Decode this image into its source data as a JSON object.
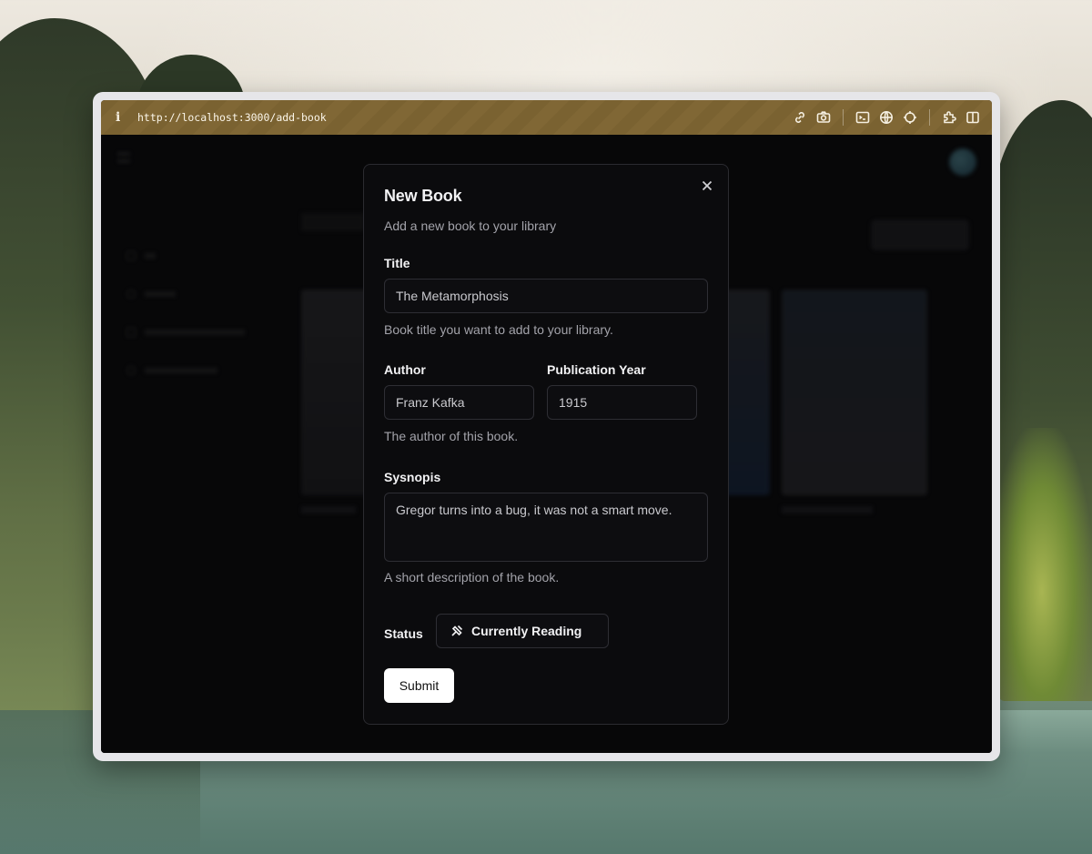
{
  "browser": {
    "url": "http://localhost:3000/add-book",
    "toolbar_icons": [
      "link-icon",
      "camera-icon",
      "terminal-icon",
      "globe-icon",
      "crosshair-icon",
      "extension-icon",
      "sidebar-icon"
    ]
  },
  "dialog": {
    "title": "New Book",
    "description": "Add a new book to your library",
    "title_field": {
      "label": "Title",
      "value": "The Metamorphosis",
      "help": "Book title you want to add to your library."
    },
    "author_field": {
      "label": "Author",
      "value": "Franz Kafka",
      "help": "The author of this book."
    },
    "year_field": {
      "label": "Publication Year",
      "value": "1915"
    },
    "synopsis_field": {
      "label": "Sysnopis",
      "value": "Gregor turns into a bug, it was not a smart move.",
      "help": "A short description of the book."
    },
    "status_field": {
      "label": "Status",
      "value": "Currently Reading"
    },
    "submit_label": "Submit"
  },
  "theme": {
    "accent_toolbar": "#7a6231",
    "dialog_bg": "#0b0b0d",
    "submit_bg": "#ffffff"
  }
}
